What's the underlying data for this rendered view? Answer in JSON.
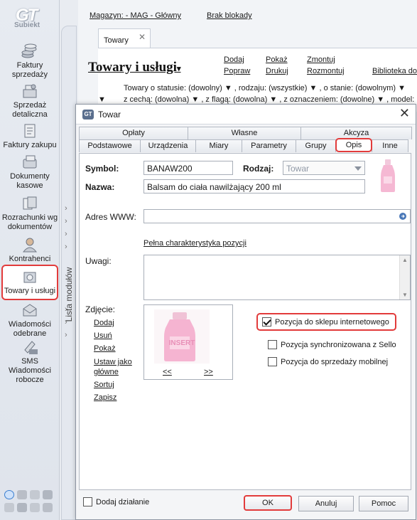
{
  "app": {
    "logo": "GT",
    "logo_sub": "Subiekt"
  },
  "sidebar": {
    "items": [
      {
        "label": "Faktury sprzedaży",
        "icon": "coins-icon"
      },
      {
        "label": "Sprzedaż detaliczna",
        "icon": "cash-register-icon"
      },
      {
        "label": "Faktury zakupu",
        "icon": "invoice-icon"
      },
      {
        "label": "Dokumenty kasowe",
        "icon": "cash-docs-icon"
      },
      {
        "label": "Rozrachunki wg dokumentów",
        "icon": "settlements-icon"
      },
      {
        "label": "Kontrahenci",
        "icon": "person-icon"
      },
      {
        "label": "Towary i usługi",
        "icon": "product-icon"
      },
      {
        "label": "Wiadomości odebrane",
        "icon": "mail-icon"
      },
      {
        "label": "SMS Wiadomości robocze",
        "icon": "sms-icon"
      }
    ],
    "active_index": 6,
    "modules_label": "Lista modułów"
  },
  "header": {
    "warehouse": "Magazyn: - MAG - Główny",
    "lock_status": "Brak blokady",
    "tab": "Towary",
    "title": "Towary i usługi",
    "actions": [
      "Dodaj",
      "Pokaż",
      "Zmontuj",
      "Popraw",
      "Drukuj",
      "Rozmontuj",
      "Biblioteka dok"
    ],
    "filter_line1": "Towary o statusie: (dowolny) ▼ , rodzaju: (wszystkie) ▼ , o stanie: (dowolnym) ▼",
    "filter_line2": "z cechą: (dowolna) ▼ , z flagą: (dowolna) ▼ , z oznaczeniem: (dowolne) ▼ , model:"
  },
  "dialog": {
    "title": "Towar",
    "tabs_top": [
      "Opłaty",
      "Własne",
      "Akcyza"
    ],
    "tabs_bottom": [
      "Podstawowe",
      "Urządzenia",
      "Miary",
      "Parametry",
      "Grupy",
      "Opis",
      "Inne"
    ],
    "active_tab": "Opis",
    "symbol_label": "Symbol:",
    "symbol_value": "BANAW200",
    "rodzaj_label": "Rodzaj:",
    "rodzaj_value": "Towar",
    "nazwa_label": "Nazwa:",
    "nazwa_value": "Balsam do ciała nawilżający 200 ml",
    "www_label": "Adres WWW:",
    "www_value": "",
    "full_char_link": "Pełna charakterystyka pozycji",
    "uwagi_label": "Uwagi:",
    "zdjecie_label": "Zdjęcie:",
    "photo_actions": [
      "Dodaj",
      "Usuń",
      "Pokaż",
      "Ustaw jako główne",
      "Sortuj",
      "Zapisz"
    ],
    "photo_prev": "<<",
    "photo_next": ">>",
    "watermark": "INSERT",
    "checkboxes": [
      {
        "label": "Pozycja do sklepu internetowego",
        "checked": true
      },
      {
        "label": "Pozycja synchronizowana z Sello",
        "checked": false
      },
      {
        "label": "Pozycja do sprzedaży mobilnej",
        "checked": false
      }
    ],
    "add_action_label": "Dodaj działanie",
    "buttons": {
      "ok": "OK",
      "cancel": "Anuluj",
      "help": "Pomoc"
    }
  }
}
